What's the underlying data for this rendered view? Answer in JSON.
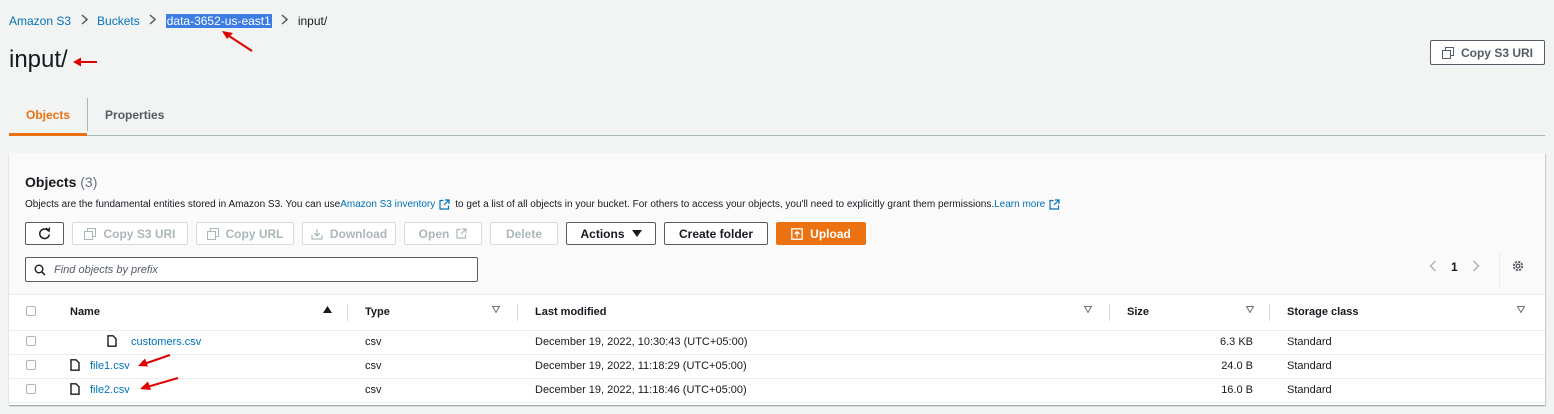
{
  "breadcrumb": {
    "items": [
      "Amazon S3",
      "Buckets",
      "data-3652-us-east1"
    ],
    "current": "input/"
  },
  "page": {
    "title": "input/"
  },
  "header_actions": {
    "copy_s3_uri": "Copy S3 URI"
  },
  "tabs": [
    {
      "label": "Objects",
      "active": true
    },
    {
      "label": "Properties",
      "active": false
    }
  ],
  "objects_panel": {
    "title": "Objects",
    "count": "(3)",
    "desc_part1": "Objects are the fundamental entities stored in Amazon S3. You can use ",
    "desc_link1": "Amazon S3 inventory",
    "desc_part2": " to get a list of all objects in your bucket. For others to access your objects, you'll need to explicitly grant them permissions. ",
    "desc_link2": "Learn more"
  },
  "toolbar": {
    "copy_s3_uri": "Copy S3 URI",
    "copy_url": "Copy URL",
    "download": "Download",
    "open": "Open",
    "delete": "Delete",
    "actions": "Actions",
    "create_folder": "Create folder",
    "upload": "Upload"
  },
  "search": {
    "placeholder": "Find objects by prefix"
  },
  "pagination": {
    "page": "1"
  },
  "table": {
    "columns": [
      "Name",
      "Type",
      "Last modified",
      "Size",
      "Storage class"
    ],
    "rows": [
      {
        "name": "customers.csv",
        "type": "csv",
        "modified": "December 19, 2022, 10:30:43 (UTC+05:00)",
        "size": "6.3 KB",
        "storage": "Standard"
      },
      {
        "name": "file1.csv",
        "type": "csv",
        "modified": "December 19, 2022, 11:18:29 (UTC+05:00)",
        "size": "24.0 B",
        "storage": "Standard"
      },
      {
        "name": "file2.csv",
        "type": "csv",
        "modified": "December 19, 2022, 11:18:46 (UTC+05:00)",
        "size": "16.0 B",
        "storage": "Standard"
      }
    ]
  },
  "colors": {
    "accent": "#ec7211",
    "link": "#0073bb",
    "annotation": "#e00000",
    "highlight": "#3c7de3"
  }
}
